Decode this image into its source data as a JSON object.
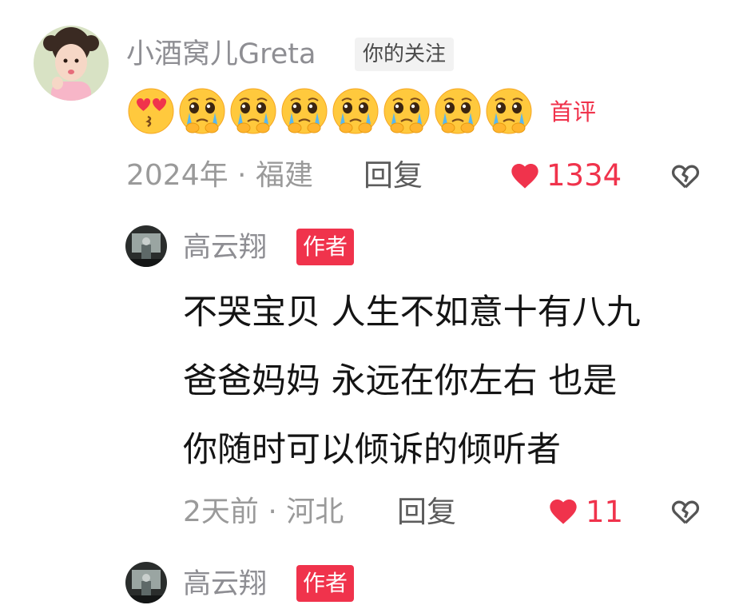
{
  "comments": [
    {
      "username": "小酒窝儿Greta",
      "tag": "你的关注",
      "emojis": [
        "heart-eyes-emoji",
        "pleading-emoji",
        "pleading-emoji",
        "pleading-emoji",
        "pleading-emoji",
        "pleading-emoji",
        "pleading-emoji",
        "pleading-emoji"
      ],
      "badge": "首评",
      "meta": "2024年 · 福建",
      "reply_label": "回复",
      "likes": "1334"
    },
    {
      "username": "高云翔",
      "tag": "作者",
      "lines": [
        "不哭宝贝 人生不如意十有八九",
        "爸爸妈妈 永远在你左右  也是",
        "你随时可以倾诉的倾听者"
      ],
      "meta": "2天前 · 河北",
      "reply_label": "回复",
      "likes": "11"
    },
    {
      "username": "高云翔",
      "tag": "作者"
    }
  ],
  "colors": {
    "accent": "#f0334c",
    "meta": "#9a9a9a",
    "text": "#141414"
  },
  "icons": [
    "heart-filled-icon",
    "dislike-broken-heart-icon"
  ]
}
